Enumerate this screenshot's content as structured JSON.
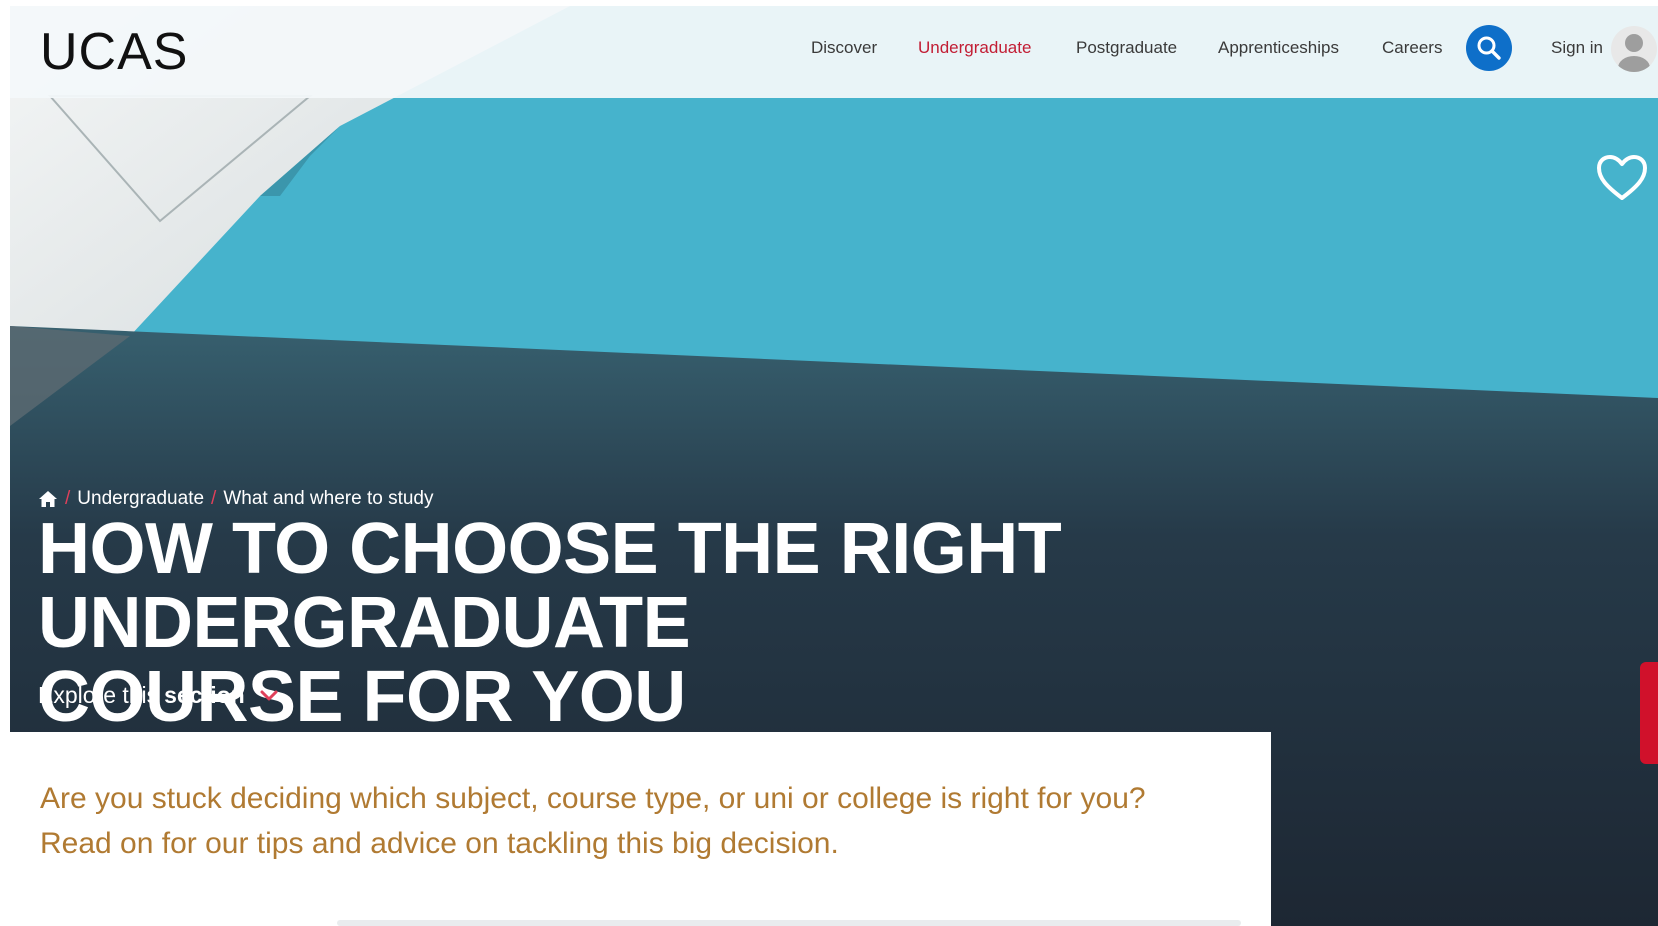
{
  "header": {
    "logo": "UCAS",
    "nav": [
      "Discover",
      "Undergraduate",
      "Postgraduate",
      "Apprenticeships",
      "Careers"
    ],
    "active_nav": "Undergraduate",
    "sign_in": "Sign in"
  },
  "hero": {
    "breadcrumb": [
      "Undergraduate",
      "What and where to study"
    ],
    "title_line1": "HOW TO CHOOSE THE RIGHT UNDERGRADUATE",
    "title_line2": "COURSE FOR YOU",
    "explore_prefix": "Explore this",
    "explore_bold": "section"
  },
  "intro": {
    "line1": "Are you stuck deciding which subject, course type, or uni or college is right for you?",
    "line2": "Read on for our tips and advice on tackling this big decision."
  },
  "colors": {
    "accent_red": "#c21d34",
    "search_blue": "#0e6fc9",
    "intro_text": "#b07a32",
    "hero_teal": "#46b3cc",
    "hero_dark": "#1f2b38"
  },
  "icons": [
    "search-icon",
    "avatar-icon",
    "heart-icon",
    "home-icon",
    "chevron-down-icon"
  ]
}
